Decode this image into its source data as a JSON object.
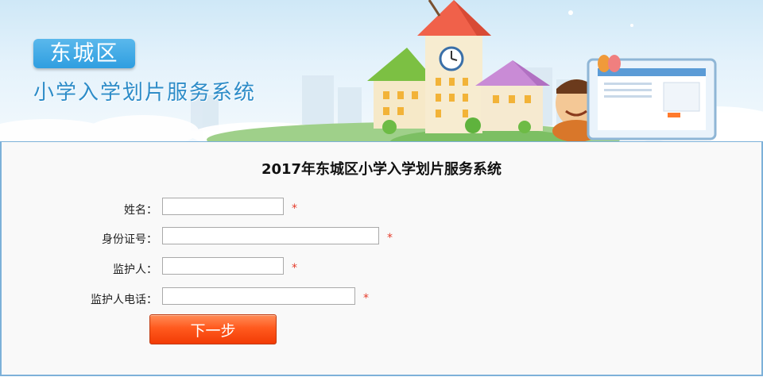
{
  "banner": {
    "badge": "东城区",
    "subtitle": "小学入学划片服务系统"
  },
  "form": {
    "title": "2017年东城区小学入学划片服务系统",
    "fields": [
      {
        "label": "姓名：",
        "value": "",
        "required_mark": "*"
      },
      {
        "label": "身份证号：",
        "value": "",
        "required_mark": "*"
      },
      {
        "label": "监护人：",
        "value": "",
        "required_mark": "*"
      },
      {
        "label": "监护人电话：",
        "value": "",
        "required_mark": "*"
      }
    ],
    "next_button": "下一步"
  },
  "colors": {
    "badge_bg": "#2f9ee0",
    "subtitle": "#2d8cc8",
    "panel_border": "#7db1d9",
    "required": "#e53c2b",
    "button": "#ff5a1e"
  },
  "icons": [
    "clock-icon",
    "butterfly-icon",
    "monitor-icon",
    "cartoon-boy"
  ]
}
